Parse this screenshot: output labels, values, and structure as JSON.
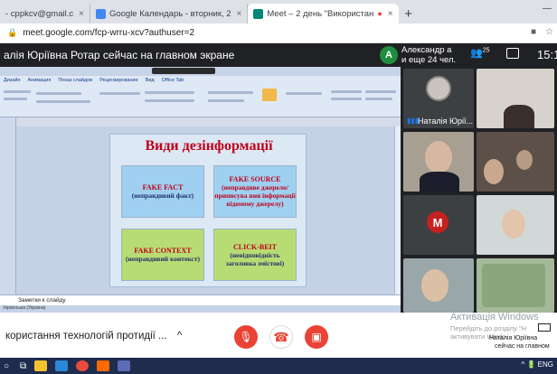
{
  "browser": {
    "tabs": [
      {
        "label": "- cppkcv@gmail.c",
        "active": false
      },
      {
        "label": "Google Календарь - вторник, 2",
        "active": false
      },
      {
        "label": "Meet – 2 день \"Використан",
        "active": true
      }
    ],
    "close_glyph": "×",
    "new_tab_glyph": "+",
    "url": "meet.google.com/fcp-wrru-xcv?authuser=2"
  },
  "header": {
    "presenting_title": "алія Юріївна Ротар сейчас на главном экране",
    "people_initial": "A",
    "people_line1": "Александр а",
    "people_line2": "и еще 24 чел.",
    "participant_count": "25",
    "clock": "15:1"
  },
  "screen": {
    "ppt_tabs": [
      "Дизайн",
      "Анимация",
      "Показ слайдов",
      "Рецензирование",
      "Вид",
      "Office Tab"
    ],
    "slide": {
      "title": "Види дезінформації",
      "boxes": [
        {
          "title": "FAKE FACT",
          "sub": "(неправдивий факт)"
        },
        {
          "title": "FAKE SOURCE",
          "sub": "(неправдиве джерело/приписува ння інформації відомому джерелу)"
        },
        {
          "title": "FAKE CONTEXT",
          "sub": "(неправдивий контекст)"
        },
        {
          "title": "CLICK-BEIT",
          "sub": "(невідповідність заголовка змістові)"
        }
      ]
    },
    "notes_placeholder": "Заметки к слайду",
    "statusbar": "Українська (Україна)"
  },
  "tiles": {
    "presenter_name": "Наталія Юрії...",
    "avatar_initial": "M",
    "avatar_color": "#c5221f"
  },
  "bottom": {
    "meeting_name": "користання технологій протидії ...",
    "chevron": "^",
    "activation_title": "Активація Windows",
    "activation_sub": "Перейдіть до розділу \"Н",
    "activation_sub2": "активувати Windo",
    "presenting_line1": "Наталія Юріївна",
    "presenting_line2": "сейчас на главном"
  },
  "taskbar": {
    "tray": "^ 🔋 ENG"
  },
  "colors": {
    "accent_red": "#ea4335",
    "meet_bg": "#202124",
    "slide_title": "#c0001a"
  }
}
